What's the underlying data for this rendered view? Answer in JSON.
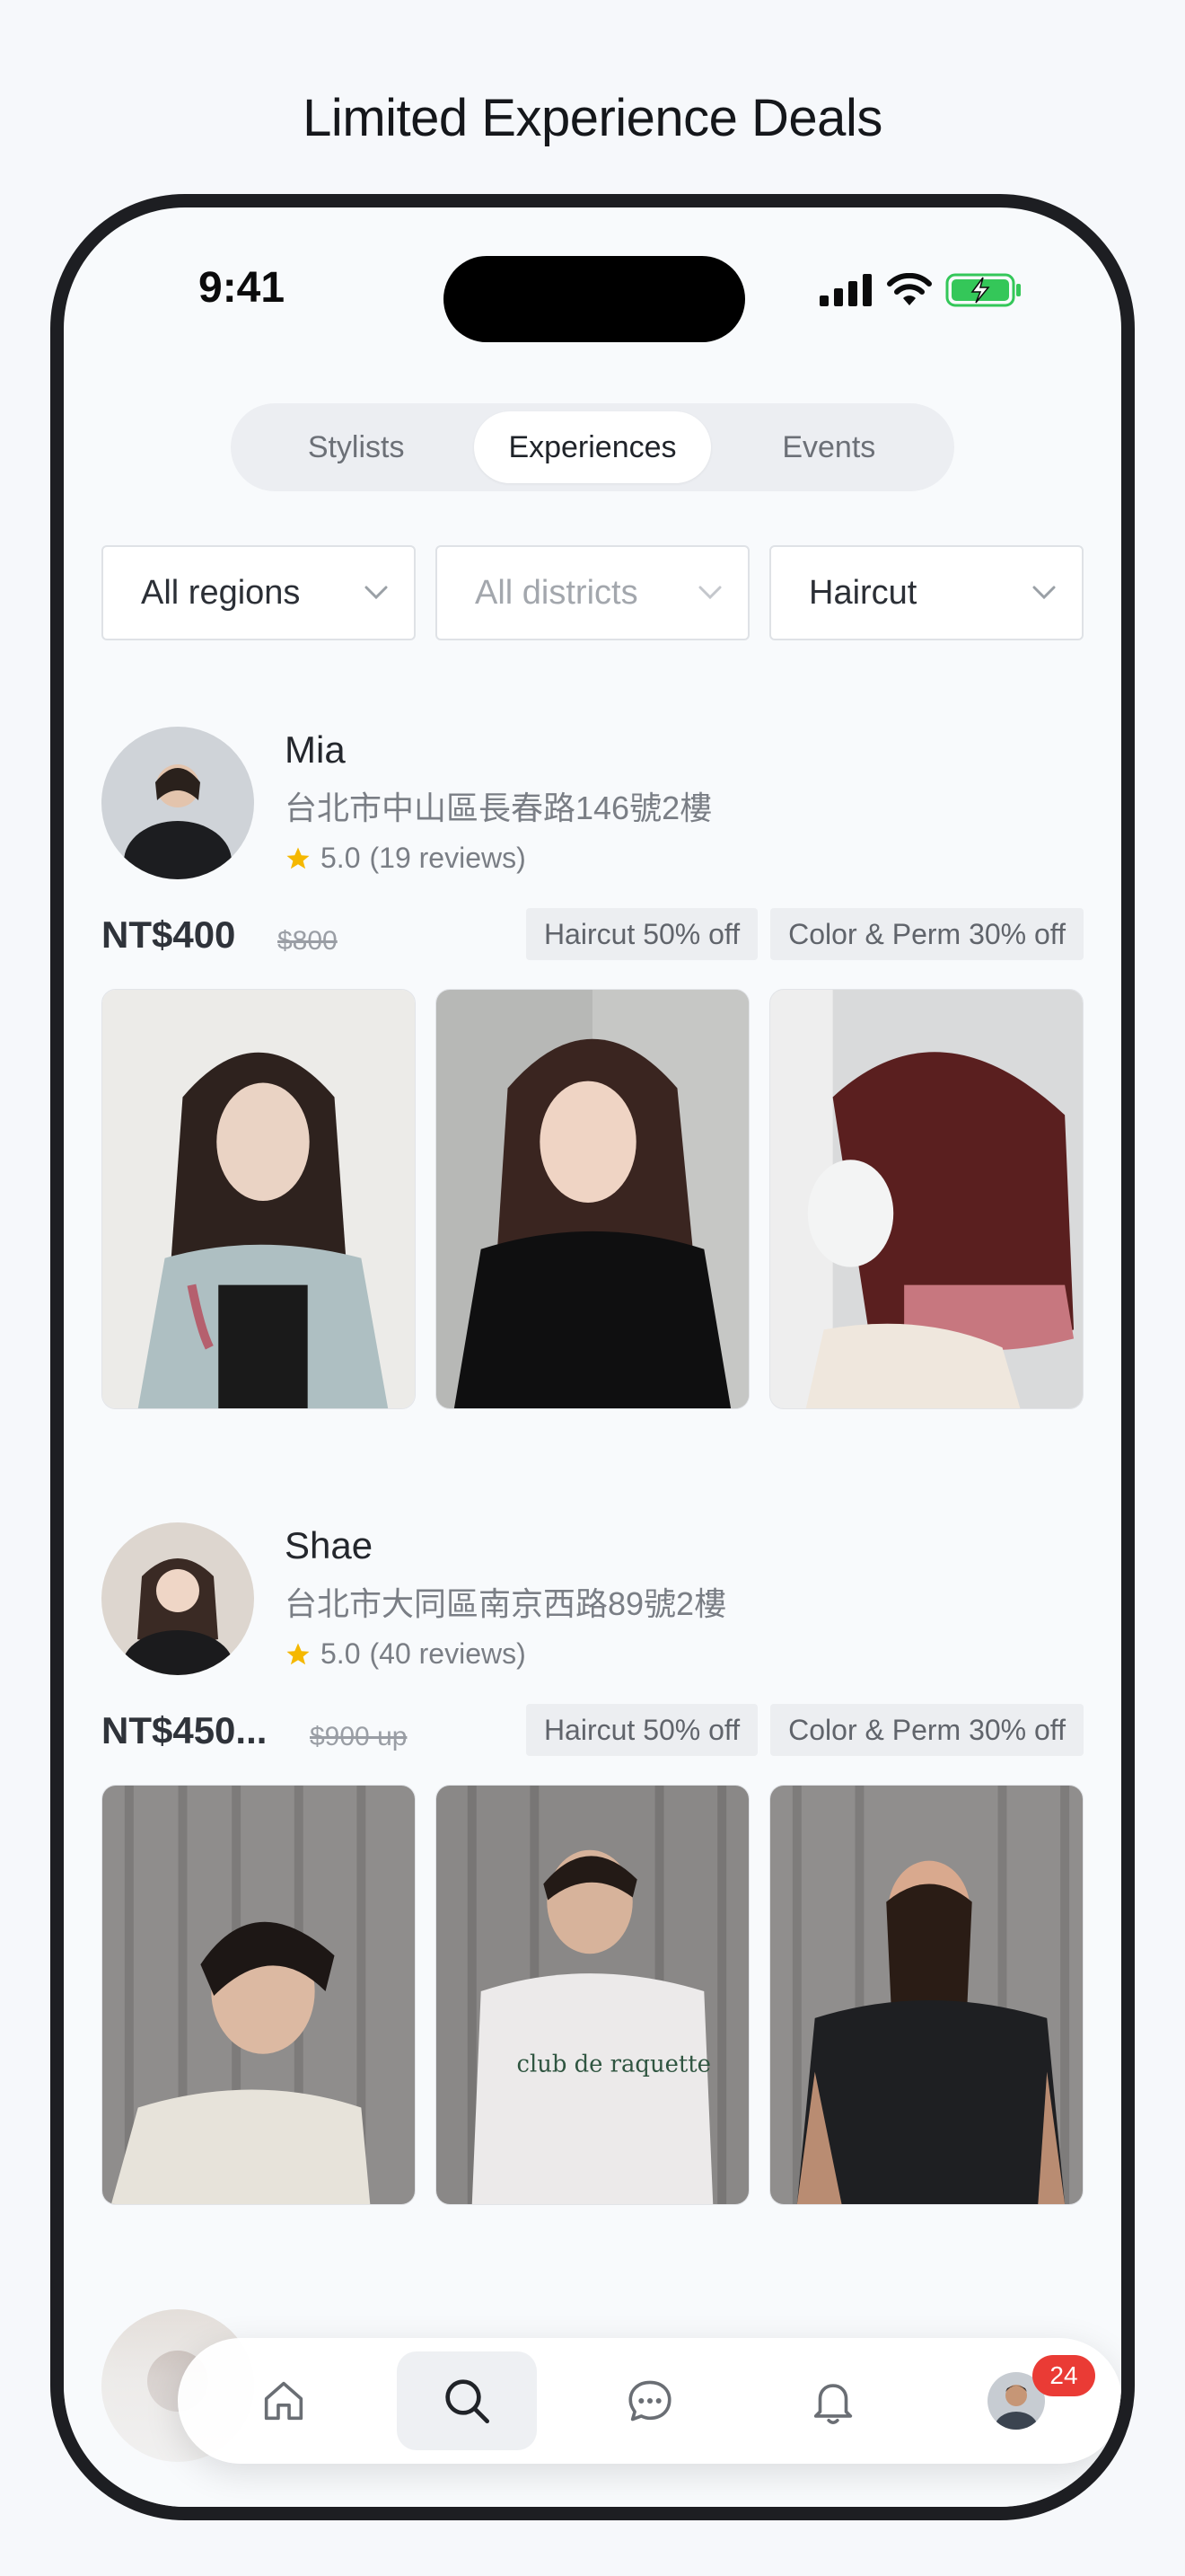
{
  "headline": "Limited Experience Deals",
  "status_bar": {
    "time": "9:41"
  },
  "segments": [
    {
      "label": "Stylists",
      "active": false
    },
    {
      "label": "Experiences",
      "active": true
    },
    {
      "label": "Events",
      "active": false
    }
  ],
  "filters": {
    "region": "All regions",
    "district": "All districts",
    "service": "Haircut"
  },
  "stylists": [
    {
      "name": "Mia",
      "address": "台北市中山區長春路146號2樓",
      "rating": "5.0",
      "reviews": "(19 reviews)",
      "price": "NT$400",
      "original_price": "$800",
      "tags": [
        "Haircut 50% off",
        "Color & Perm 30% off"
      ]
    },
    {
      "name": "Shae",
      "address": "台北市大同區南京西路89號2樓",
      "rating": "5.0",
      "reviews": "(40 reviews)",
      "price": "NT$450...",
      "original_price": "$900 up",
      "tags": [
        "Haircut 50% off",
        "Color & Perm 30% off"
      ]
    }
  ],
  "tabbar": {
    "items": [
      "home-icon",
      "search-icon",
      "chat-icon",
      "bell-icon",
      "profile-avatar"
    ],
    "active": "search-icon",
    "notification_count": "24"
  },
  "colors": {
    "accent_star": "#f5b800",
    "badge": "#ea3b35",
    "battery": "#34c759"
  }
}
